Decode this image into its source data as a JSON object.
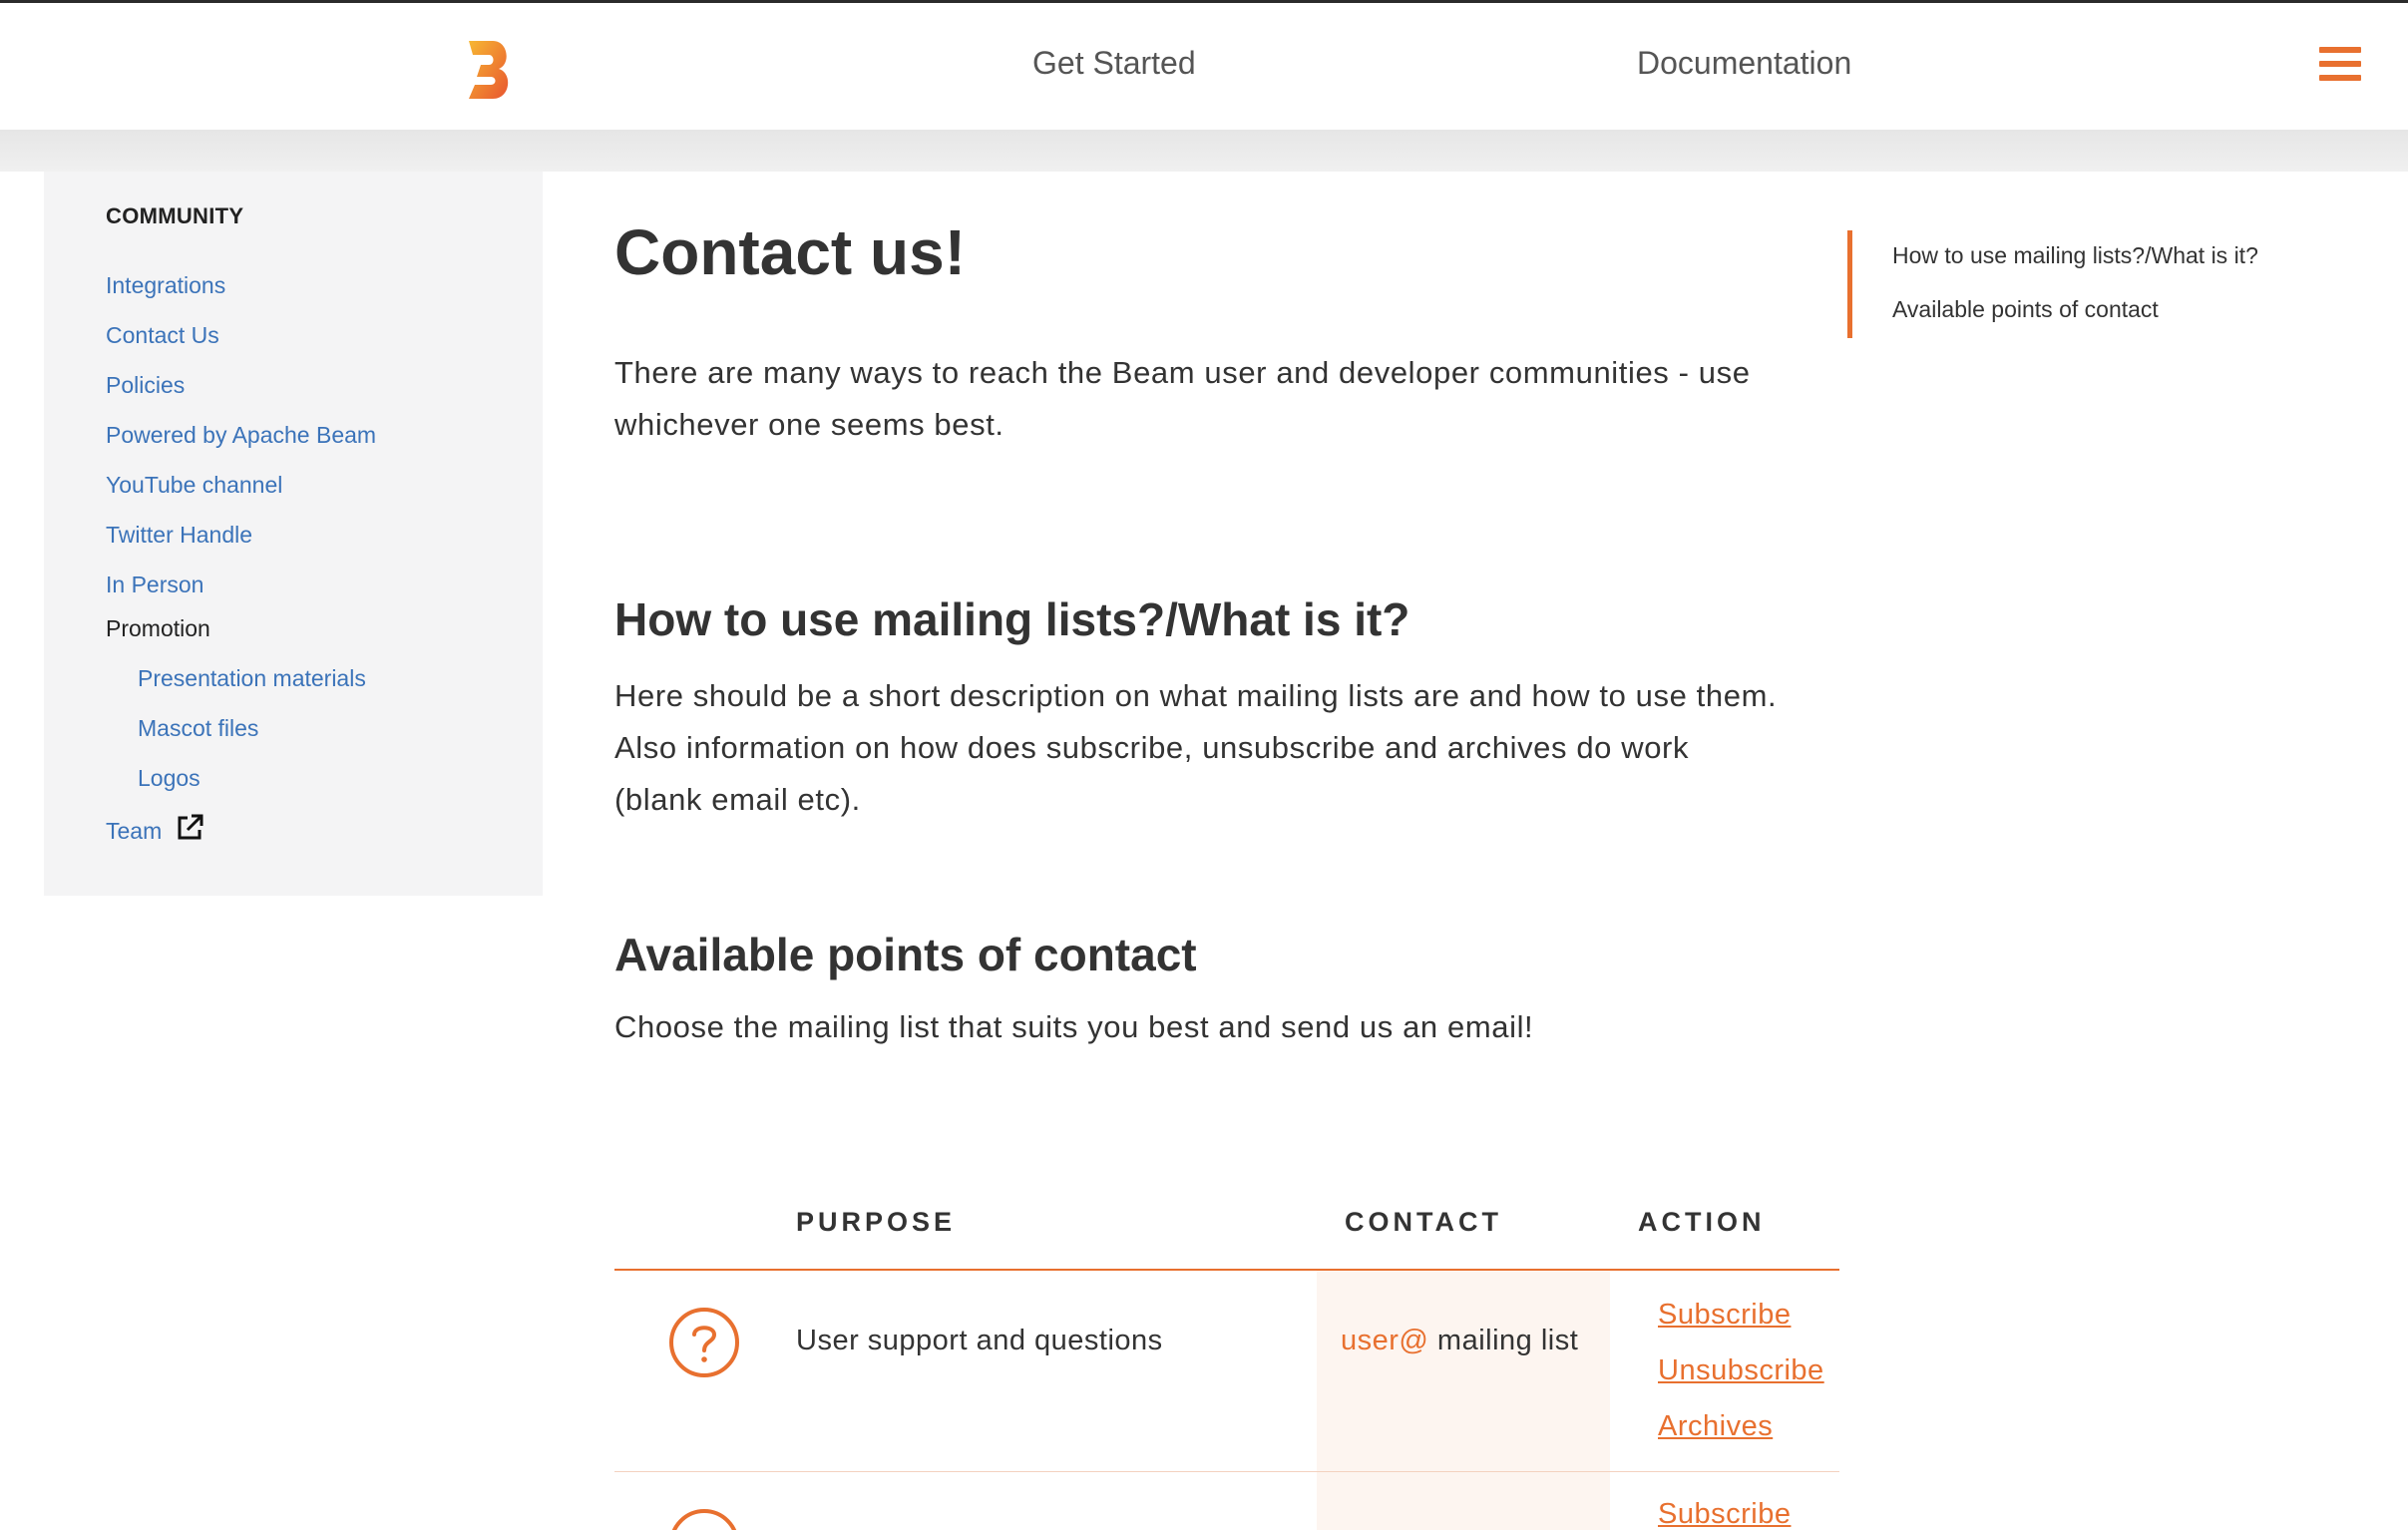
{
  "header": {
    "logo_name": "beam-logo",
    "nav": [
      {
        "label": "Get Started"
      },
      {
        "label": "Documentation"
      }
    ],
    "menu_icon": "hamburger-menu-icon",
    "accent_color": "#e8702f"
  },
  "sidebar": {
    "title": "COMMUNITY",
    "items": [
      {
        "label": "Integrations"
      },
      {
        "label": "Contact Us"
      },
      {
        "label": "Policies"
      },
      {
        "label": "Powered by Apache Beam"
      },
      {
        "label": "YouTube channel"
      },
      {
        "label": "Twitter Handle"
      },
      {
        "label": "In Person"
      }
    ],
    "promotion": {
      "label": "Promotion",
      "children": [
        {
          "label": "Presentation materials"
        },
        {
          "label": "Mascot files"
        },
        {
          "label": "Logos"
        }
      ]
    },
    "team": {
      "label": "Team",
      "icon": "external-link-icon"
    },
    "link_color": "#3b73b9"
  },
  "main": {
    "title": "Contact us!",
    "intro_line1": "There are many ways to reach the Beam user and developer communities - use",
    "intro_line2": "whichever one seems best.",
    "section1": {
      "heading": "How to use mailing lists?/What is it?",
      "line1": "Here should be a short description on what mailing lists are and how to use them.",
      "line2": "Also information on how does subscribe, unsubscribe and archives do work",
      "line3": "(blank email etc)."
    },
    "section2": {
      "heading": "Available points of contact",
      "text": "Choose the mailing list that suits you best and send us an email!"
    }
  },
  "toc": {
    "items": [
      {
        "label": "How to use mailing lists?/What is it?"
      },
      {
        "label": "Available points of contact"
      }
    ]
  },
  "table": {
    "headers": {
      "purpose": "PURPOSE",
      "contact": "CONTACT",
      "action": "ACTION"
    },
    "rows": [
      {
        "icon": "question-circle-icon",
        "purpose": "User support and questions",
        "contact_prefix": "user@",
        "contact_suffix": " mailing list",
        "actions": [
          "Subscribe",
          "Unsubscribe",
          "Archives"
        ]
      },
      {
        "icon": "question-circle-icon",
        "actions": [
          "Subscribe"
        ]
      }
    ]
  }
}
